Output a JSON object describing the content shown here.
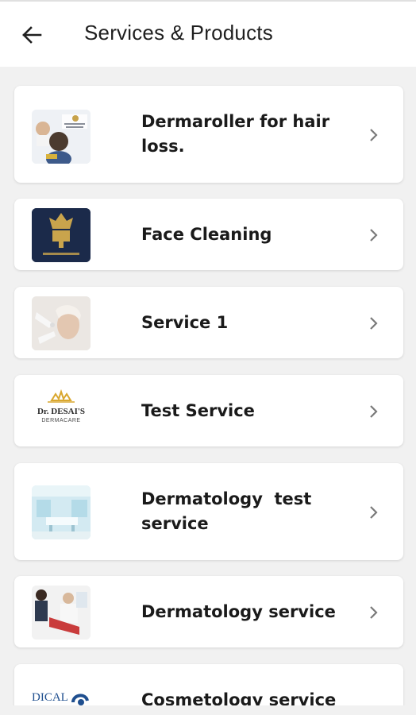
{
  "header": {
    "back_icon": "arrow-left-icon",
    "title": "Services & Products"
  },
  "items": [
    {
      "label": "Dermaroller for hair loss.",
      "thumb_icon": "hair-treatment-photo"
    },
    {
      "label": "Face Cleaning",
      "thumb_icon": "cosmetic-derma-logo"
    },
    {
      "label": "Service 1",
      "thumb_icon": "facial-treatment-photo"
    },
    {
      "label": "Test Service",
      "thumb_icon": "dr-desais-dermacare-logo",
      "logo_line1": "Dr. DESAI'S",
      "logo_line2": "DERMACARE"
    },
    {
      "label": "Dermatology  test service",
      "thumb_icon": "clinic-room-photo"
    },
    {
      "label": "Dermatology service",
      "thumb_icon": "consultation-photo"
    },
    {
      "label": "Cosmetology service",
      "thumb_icon": "medical-logo",
      "logo_text": "DICAL"
    }
  ],
  "colors": {
    "background": "#f1f1f1",
    "card": "#ffffff",
    "text": "#1a1a1a",
    "chevron": "#7a7a7a"
  }
}
